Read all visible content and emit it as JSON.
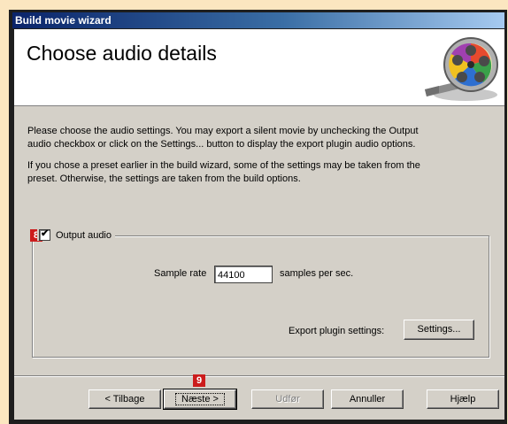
{
  "window": {
    "title": "Build movie wizard"
  },
  "header": {
    "title": "Choose audio details",
    "icon": "film-reel-icon"
  },
  "description": {
    "p1_line1": "Please choose the audio settings. You may export a silent movie by unchecking the Output",
    "p1_line2": "audio checkbox or click on the Settings... button to display the export plugin audio options.",
    "p2_line1": "If you chose a preset earlier in the build wizard, some of the settings may be taken from the",
    "p2_line2": "preset. Otherwise, the settings are taken from the build options."
  },
  "output_audio": {
    "label": "Output audio",
    "checked": true,
    "badge": "8"
  },
  "sample_rate": {
    "label": "Sample rate",
    "value": "44100",
    "unit": "samples per sec."
  },
  "export_plugin": {
    "label": "Export plugin settings:",
    "button": "Settings..."
  },
  "buttons": {
    "back": "< Tilbage",
    "next": "Næste >",
    "next_badge": "9",
    "finish": "Udfør",
    "cancel": "Annuller",
    "help": "Hjælp"
  },
  "colors": {
    "page_bg": "#fbe6c0",
    "badge": "#cc1c1c",
    "title_start": "#0a246a"
  }
}
